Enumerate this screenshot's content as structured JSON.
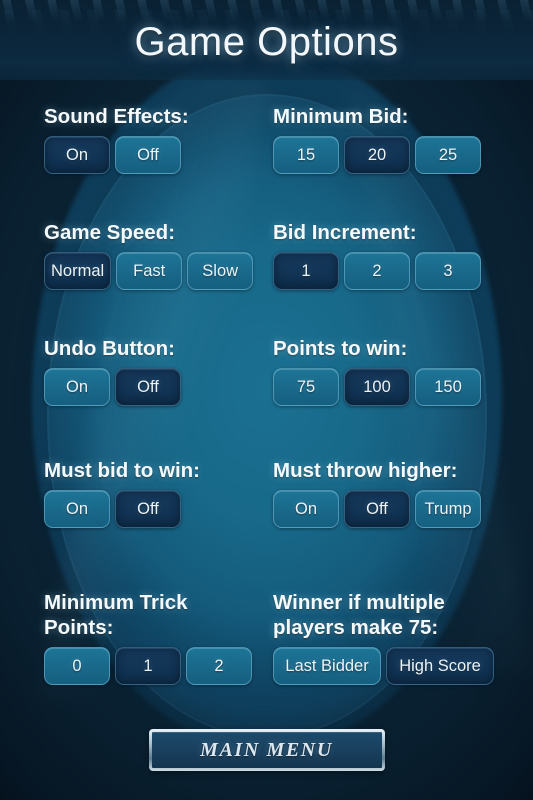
{
  "header": {
    "title": "Game Options"
  },
  "options": [
    {
      "key": "sound-effects",
      "label": "Sound Effects:",
      "choices": [
        {
          "label": "On",
          "selected": true
        },
        {
          "label": "Off",
          "selected": false
        }
      ]
    },
    {
      "key": "minimum-bid",
      "label": "Minimum Bid:",
      "choices": [
        {
          "label": "15",
          "selected": false
        },
        {
          "label": "20",
          "selected": true
        },
        {
          "label": "25",
          "selected": false
        }
      ]
    },
    {
      "key": "game-speed",
      "label": "Game Speed:",
      "choices": [
        {
          "label": "Normal",
          "selected": true
        },
        {
          "label": "Fast",
          "selected": false
        },
        {
          "label": "Slow",
          "selected": false
        }
      ]
    },
    {
      "key": "bid-increment",
      "label": "Bid Increment:",
      "choices": [
        {
          "label": "1",
          "selected": true
        },
        {
          "label": "2",
          "selected": false
        },
        {
          "label": "3",
          "selected": false
        }
      ]
    },
    {
      "key": "undo-button",
      "label": "Undo Button:",
      "choices": [
        {
          "label": "On",
          "selected": false
        },
        {
          "label": "Off",
          "selected": true
        }
      ]
    },
    {
      "key": "points-to-win",
      "label": "Points to win:",
      "choices": [
        {
          "label": "75",
          "selected": false
        },
        {
          "label": "100",
          "selected": true
        },
        {
          "label": "150",
          "selected": false
        }
      ]
    },
    {
      "key": "must-bid-to-win",
      "label": "Must bid to win:",
      "choices": [
        {
          "label": "On",
          "selected": false
        },
        {
          "label": "Off",
          "selected": true
        }
      ]
    },
    {
      "key": "must-throw-higher",
      "label": "Must throw higher:",
      "choices": [
        {
          "label": "On",
          "selected": false
        },
        {
          "label": "Off",
          "selected": true
        },
        {
          "label": "Trump",
          "selected": false
        }
      ]
    },
    {
      "key": "minimum-trick-points",
      "label": "Minimum Trick\nPoints:",
      "choices": [
        {
          "label": "0",
          "selected": false
        },
        {
          "label": "1",
          "selected": true
        },
        {
          "label": "2",
          "selected": false
        }
      ]
    },
    {
      "key": "winner-if-multiple",
      "label": "Winner if multiple\nplayers make 75:",
      "wide": true,
      "choices": [
        {
          "label": "Last Bidder",
          "selected": false
        },
        {
          "label": "High Score",
          "selected": true
        }
      ]
    }
  ],
  "footer": {
    "main_menu_label": "MAIN MENU"
  },
  "colors": {
    "selected_button": "#123455",
    "unselected_button": "#19688a",
    "background_center": "#1b7091",
    "background_edge": "#0a2133",
    "text": "#f4f9fc"
  }
}
